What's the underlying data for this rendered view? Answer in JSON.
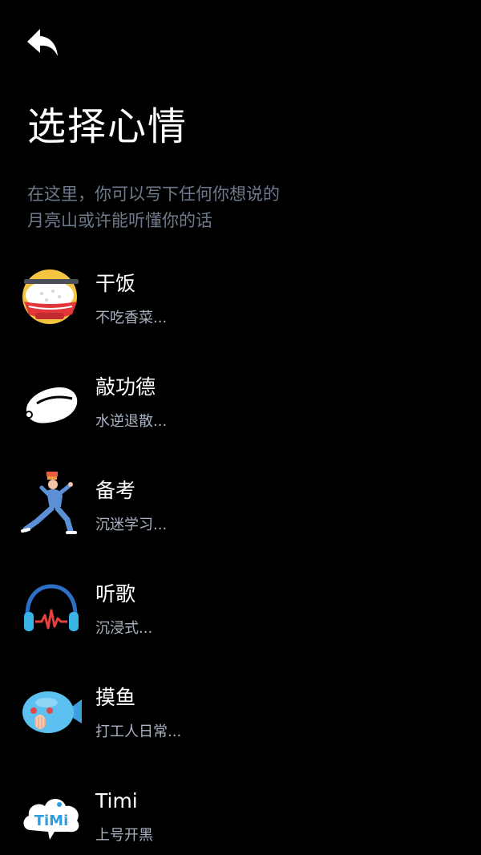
{
  "header": {
    "back_icon": "undo-arrow-icon",
    "title": "选择心情"
  },
  "intro": {
    "line1": "在这里，你可以写下任何你想说的",
    "line2": "月亮山或许能听懂你的话"
  },
  "moods": [
    {
      "title": "干饭",
      "desc": "不吃香菜...",
      "icon": "rice-bowl-icon"
    },
    {
      "title": "敲功德",
      "desc": "水逆退散...",
      "icon": "wooden-fish-icon"
    },
    {
      "title": "备考",
      "desc": "沉迷学习...",
      "icon": "student-stretch-icon"
    },
    {
      "title": "听歌",
      "desc": "沉浸式...",
      "icon": "headphones-icon"
    },
    {
      "title": "摸鱼",
      "desc": "打工人日常...",
      "icon": "fish-icon"
    },
    {
      "title": "Timi",
      "desc": "上号开黑",
      "icon": "timi-cloud-icon",
      "icon_text": "TiMi"
    }
  ],
  "colors": {
    "background": "#000000",
    "subtitle": "#6e7a8c",
    "desc": "#a9b3c2"
  }
}
